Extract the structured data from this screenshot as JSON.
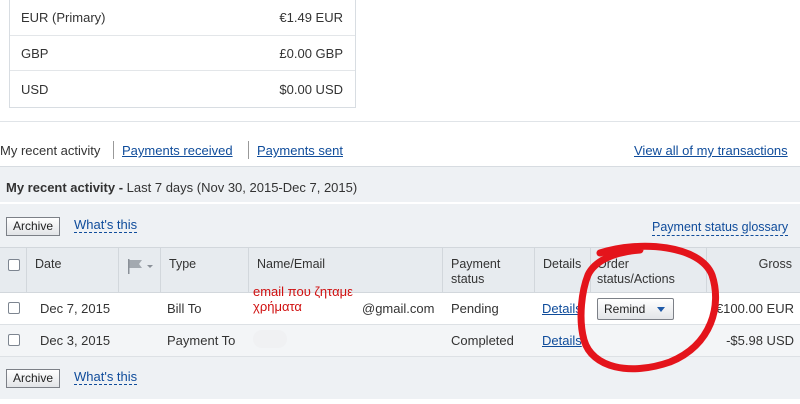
{
  "balances": [
    {
      "currency": "EUR (Primary)",
      "amount": "€1.49 EUR"
    },
    {
      "currency": "GBP",
      "amount": "£0.00 GBP"
    },
    {
      "currency": "USD",
      "amount": "$0.00 USD"
    }
  ],
  "tabs": {
    "current": "My recent activity",
    "payments_received": "Payments received",
    "payments_sent": "Payments sent",
    "view_all": "View all of my transactions"
  },
  "activity": {
    "title": "My recent activity -",
    "range": "Last 7 days (Nov 30, 2015-Dec 7, 2015)"
  },
  "toolbar": {
    "archive": "Archive",
    "whats_this": "What's this",
    "glossary": "Payment status glossary"
  },
  "columns": {
    "date": "Date",
    "type": "Type",
    "name": "Name/Email",
    "status_l1": "Payment",
    "status_l2": "status",
    "details": "Details",
    "order_l1": "Order",
    "order_l2": "status/Actions",
    "gross": "Gross"
  },
  "rows": [
    {
      "date": "Dec 7, 2015",
      "type": "Bill To",
      "email": "@gmail.com",
      "status": "Pending",
      "details": "Details",
      "action": "Remind",
      "gross": "€100.00 EUR"
    },
    {
      "date": "Dec 3, 2015",
      "type": "Payment To",
      "email": "",
      "status": "Completed",
      "details": "Details",
      "action": "",
      "gross": "-$5.98 USD"
    }
  ],
  "annotation": {
    "line1": "email που ζηταμε",
    "line2": "χρήματα",
    "color": "#d01010"
  },
  "icons": {
    "flag": "flag-icon",
    "caret": "caret-down-icon"
  }
}
